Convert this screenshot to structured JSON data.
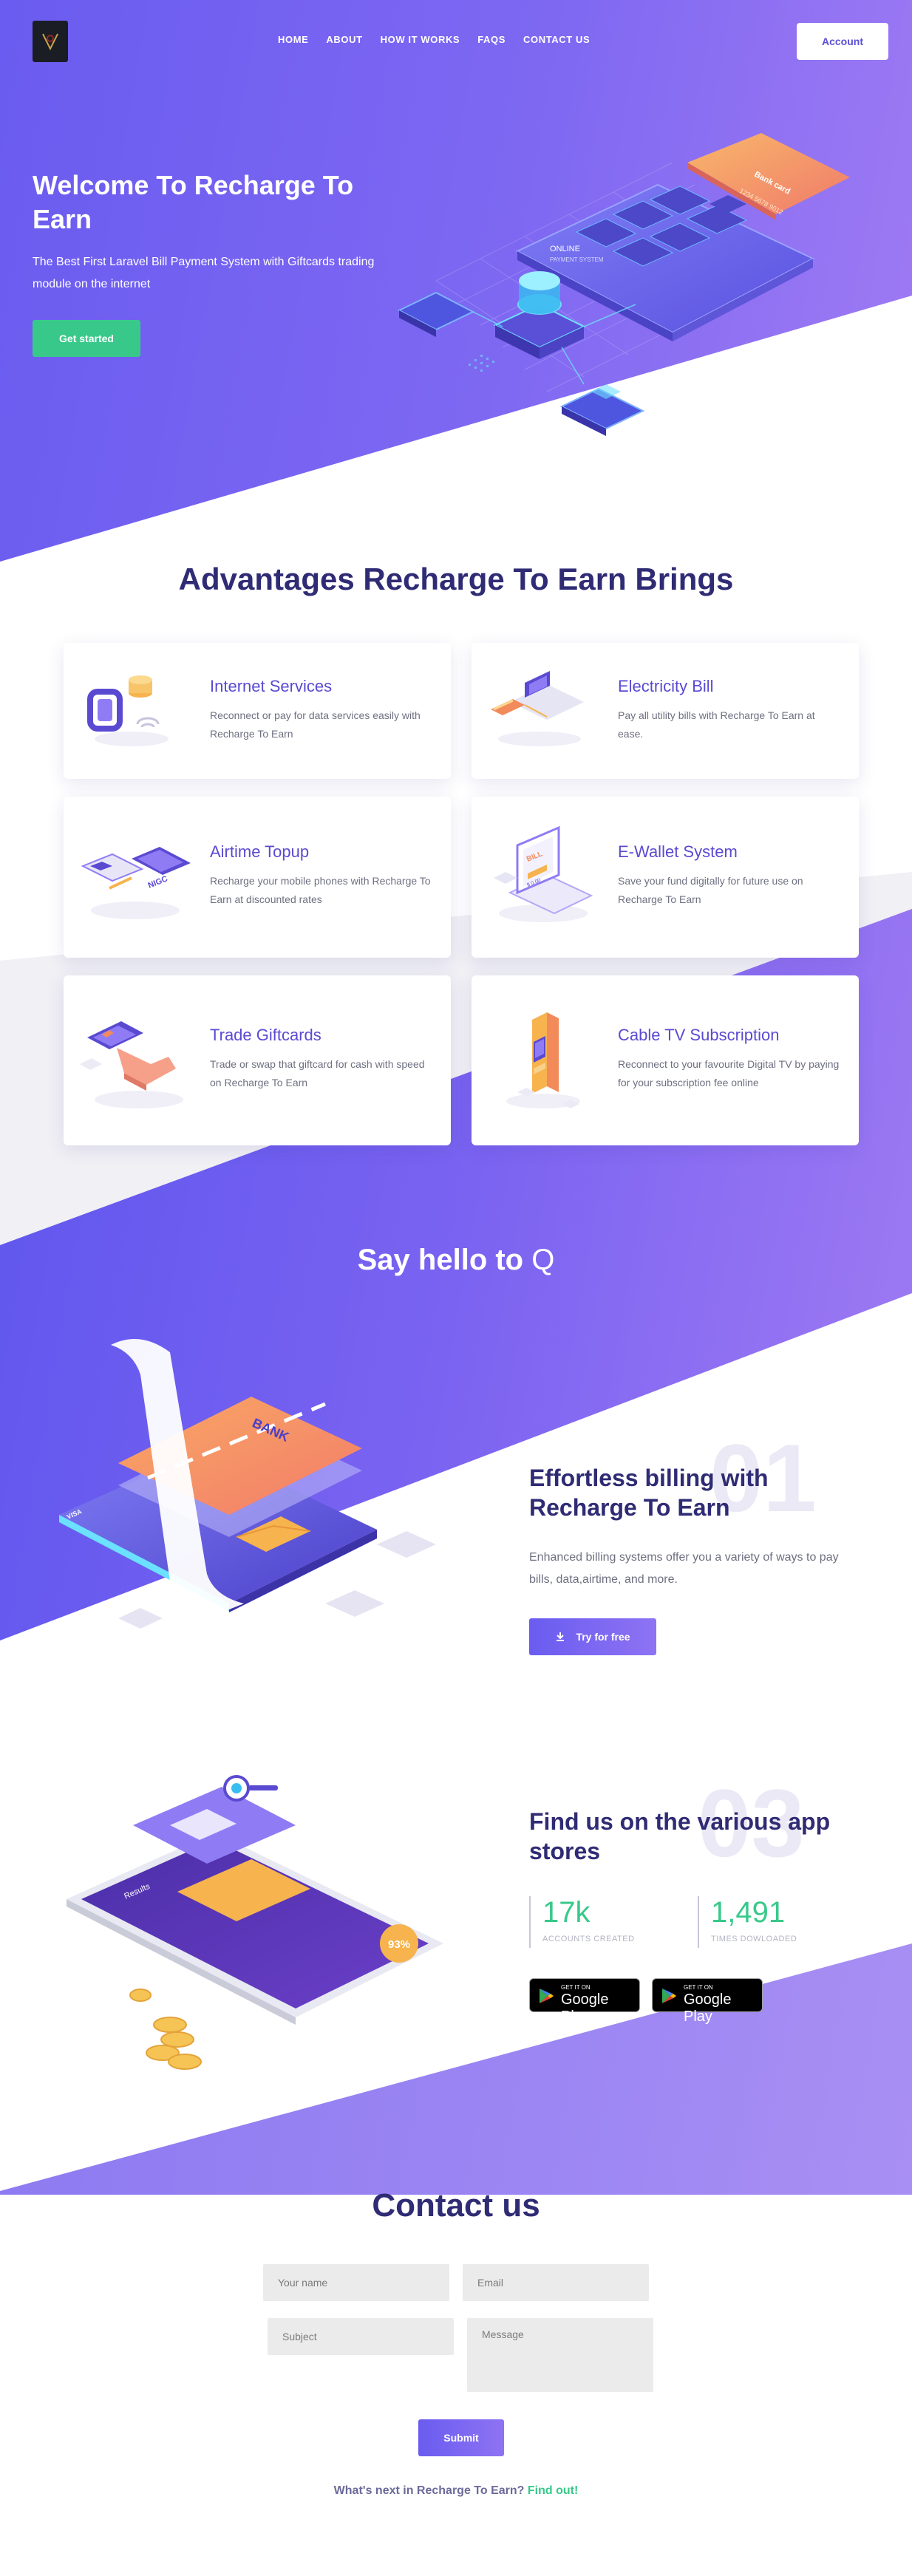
{
  "nav": {
    "items": [
      "HOME",
      "ABOUT",
      "HOW IT WORKS",
      "FAQS",
      "CONTACT US"
    ],
    "account_label": "Account"
  },
  "hero": {
    "title": "Welcome To Recharge To Earn",
    "subtitle": "The Best First Laravel Bill Payment System with Giftcards trading module on the internet",
    "cta": "Get started",
    "illustration": {
      "card_label": "Bank card",
      "card_number": "1234 5678 9012",
      "screen_label": "ONLINE",
      "screen_sub": "PAYMENT SYSTEM"
    }
  },
  "advantages": {
    "title": "Advantages Recharge To Earn Brings",
    "cards": [
      {
        "title": "Internet Services",
        "desc": "Reconnect or pay for data services easily with Recharge To Earn",
        "icon": "smartwatch-icon"
      },
      {
        "title": "Electricity Bill",
        "desc": "Pay all utility bills with Recharge To Earn at ease.",
        "icon": "laptop-card-icon"
      },
      {
        "title": "Airtime Topup",
        "desc": "Recharge your mobile phones with Recharge To Earn at discounted rates",
        "icon": "phones-icon"
      },
      {
        "title": "E-Wallet System",
        "desc": "Save your fund digitally for future use on Recharge To Earn",
        "icon": "laptop-wallet-icon"
      },
      {
        "title": "Trade Giftcards",
        "desc": "Trade or swap that giftcard for cash with speed on Recharge To Earn",
        "icon": "hand-card-icon"
      },
      {
        "title": "Cable TV Subscription",
        "desc": "Reconnect to your favourite Digital TV by paying for your subscription fee online",
        "icon": "kiosk-icon"
      }
    ],
    "illustration_texts": {
      "phone_big": "NIGC",
      "laptop_bill": "BILL",
      "laptop_amount": "$ 0.00"
    }
  },
  "say_hello": {
    "title": "Say hello to ",
    "title_accent": "Q",
    "illustration": {
      "bank": "BANK",
      "card_brand": "VISA"
    },
    "feature": {
      "number": "01",
      "title": "Effortless billing with Recharge To Earn",
      "desc": "Enhanced billing systems offer you a variety of ways to pay bills, data,airtime, and more.",
      "cta": "Try for free"
    }
  },
  "stores": {
    "number": "03",
    "title": "Find us on the various app stores",
    "illustration": {
      "percent": "93%",
      "app_label": "Results"
    },
    "stats": [
      {
        "value": "17k",
        "label": "ACCOUNTS CREATED"
      },
      {
        "value": "1,491",
        "label": "TIMES DOWLOADED"
      }
    ],
    "badges": [
      {
        "small": "GET IT ON",
        "big": "Google Play"
      },
      {
        "small": "GET IT ON",
        "big": "Google Play"
      }
    ]
  },
  "contact": {
    "title": "Contact us",
    "name_placeholder": "Your name",
    "email_placeholder": "Email",
    "subject_placeholder": "Subject",
    "message_placeholder": "Message",
    "submit": "Submit",
    "whats_next": "What's next in Recharge To Earn?",
    "find_out": "Find out!"
  },
  "colors": {
    "primary": "#6a5cf0",
    "accent": "#a07bf3",
    "green": "#38c98a",
    "heading": "#2f2b74"
  }
}
